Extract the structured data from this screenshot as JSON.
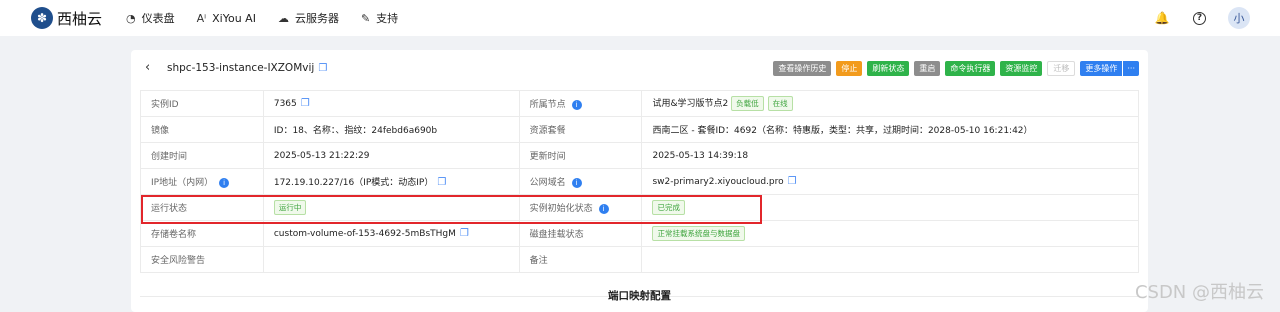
{
  "brand": {
    "logo_char": "✽",
    "name": "西柚云"
  },
  "nav": [
    {
      "icon": "dashboard-icon",
      "glyph": "◔",
      "label": "仪表盘"
    },
    {
      "icon": "ai-icon",
      "glyph": "Aⁱ",
      "label": "XiYou AI"
    },
    {
      "icon": "cloud-icon",
      "glyph": "☁",
      "label": "云服务器"
    },
    {
      "icon": "wrench-icon",
      "glyph": "✎",
      "label": "支持"
    }
  ],
  "topright": {
    "bell_glyph": "🔔",
    "help_glyph": "?",
    "avatar": "小"
  },
  "header": {
    "back_glyph": "‹",
    "instance_name": "shpc-153-instance-IXZOMvij",
    "copy_glyph": "❐"
  },
  "actions": {
    "history": "查看操作历史",
    "stop": "停止",
    "refresh": "刷新状态",
    "restart": "重启",
    "cmd": "命令执行器",
    "monitor": "资源监控",
    "migrate": "迁移",
    "more": "更多操作",
    "more_dots": "···"
  },
  "rows": {
    "instance_id": {
      "k": "实例ID",
      "v": "7365"
    },
    "node": {
      "k": "所属节点",
      "v": "试用&学习版节点2",
      "tags": [
        "负载低",
        "在线"
      ]
    },
    "image": {
      "k": "镜像",
      "v": "ID：18、名称：、指纹：24febd6a690b"
    },
    "package": {
      "k": "资源套餐",
      "v": "西南二区 - 套餐ID：4692（名称：特惠版，类型：共享，过期时间：2028-05-10 16:21:42）"
    },
    "created": {
      "k": "创建时间",
      "v": "2025-05-13 21:22:29"
    },
    "updated": {
      "k": "更新时间",
      "v": "2025-05-13 14:39:18"
    },
    "ip": {
      "k": "IP地址（内网）",
      "v": "172.19.10.227/16（IP模式：动态IP）"
    },
    "domain": {
      "k": "公网域名",
      "v": "sw2-primary2.xiyoucloud.pro"
    },
    "status": {
      "k": "运行状态",
      "tag": "运行中"
    },
    "init": {
      "k": "实例初始化状态",
      "tag": "已完成"
    },
    "volume": {
      "k": "存储卷名称",
      "v": "custom-volume-of-153-4692-5mBsTHgM"
    },
    "disk": {
      "k": "磁盘挂载状态",
      "tag": "正常挂载系统盘与数据盘"
    },
    "risk": {
      "k": "安全风险警告",
      "v": ""
    },
    "note": {
      "k": "备注",
      "v": ""
    }
  },
  "info_glyph": "i",
  "section_title": "端口映射配置",
  "watermark": "CSDN @西柚云"
}
